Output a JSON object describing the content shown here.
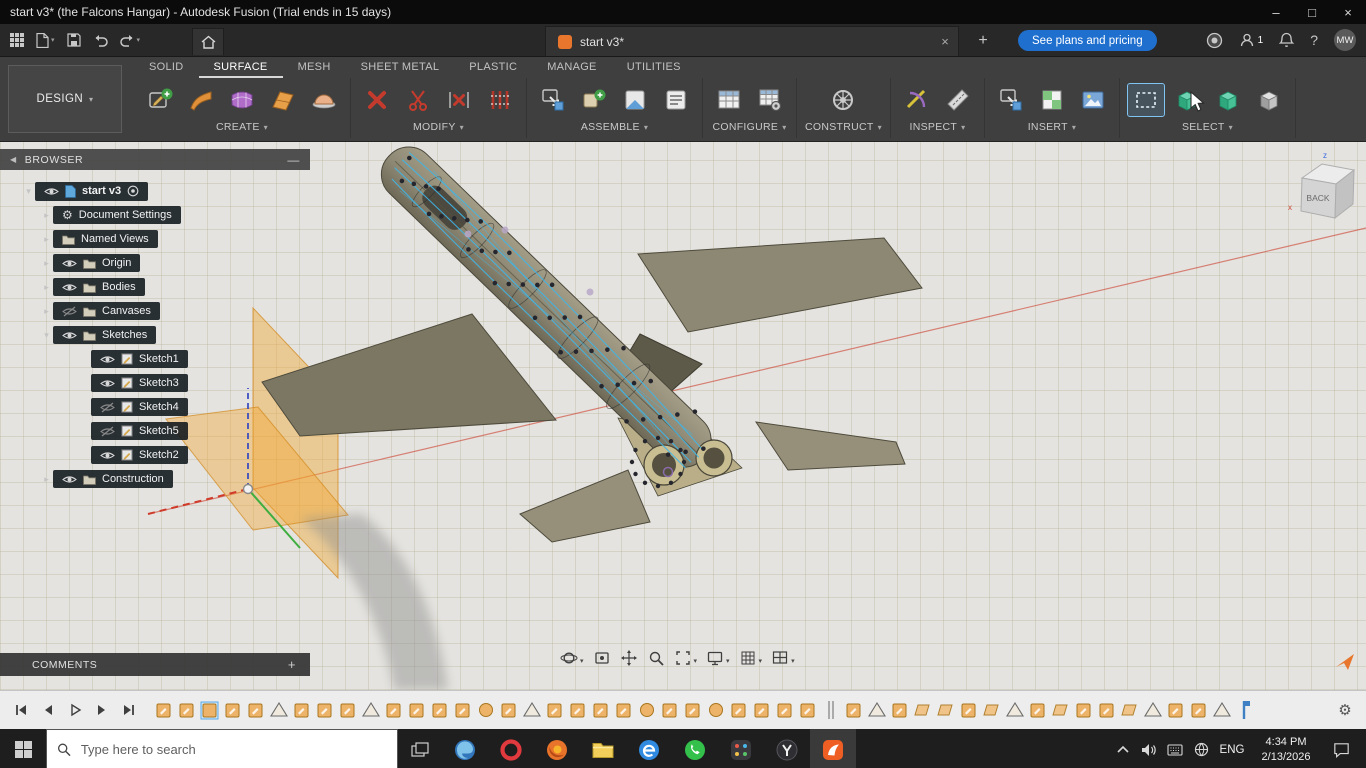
{
  "titlebar": {
    "title": "start v3* (the Falcons Hangar) - Autodesk Fusion (Trial ends in 15 days)",
    "window_controls": [
      {
        "name": "minimize-icon",
        "glyph": "–"
      },
      {
        "name": "maximize-icon",
        "glyph": "□"
      },
      {
        "name": "close-icon",
        "glyph": "×"
      }
    ]
  },
  "appbar": {
    "left_icons": [
      {
        "name": "app-launcher-icon",
        "caret": false
      },
      {
        "name": "new-design-icon",
        "caret": true
      },
      {
        "name": "save-icon",
        "caret": false
      },
      {
        "name": "undo-icon",
        "caret": false
      },
      {
        "name": "redo-icon",
        "caret": true
      }
    ],
    "home_icon": "home-icon",
    "document_tab": {
      "label": "start v3*",
      "close_glyph": "×"
    },
    "add_tab_glyph": "+",
    "plans_button": "See plans and pricing",
    "right_icons": [
      {
        "name": "job-status-icon"
      },
      {
        "name": "profile-icon",
        "badge": "1"
      },
      {
        "name": "notifications-icon"
      },
      {
        "name": "help-icon"
      }
    ],
    "avatar": "MW"
  },
  "ribbon": {
    "workspace": "DESIGN",
    "tabs": [
      {
        "label": "SOLID",
        "active": false
      },
      {
        "label": "SURFACE",
        "active": true
      },
      {
        "label": "MESH",
        "active": false
      },
      {
        "label": "SHEET METAL",
        "active": false
      },
      {
        "label": "PLASTIC",
        "active": false
      },
      {
        "label": "MANAGE",
        "active": false
      },
      {
        "label": "UTILITIES",
        "active": false
      }
    ],
    "groups": [
      {
        "label": "CREATE",
        "icons": [
          {
            "name": "create-sketch-icon",
            "kind": "sketch-new"
          },
          {
            "name": "extrude-icon",
            "kind": "orange-sheet"
          },
          {
            "name": "patch-icon",
            "kind": "purple-patch"
          },
          {
            "name": "loft-icon",
            "kind": "orange-fold"
          },
          {
            "name": "revolve-icon",
            "kind": "sphere"
          }
        ]
      },
      {
        "label": "MODIFY",
        "icons": [
          {
            "name": "trim-icon",
            "kind": "red-x"
          },
          {
            "name": "extend-icon",
            "kind": "red-scissors"
          },
          {
            "name": "stitch-icon",
            "kind": "red-extend"
          },
          {
            "name": "unstitch-icon",
            "kind": "red-stitch"
          }
        ]
      },
      {
        "label": "ASSEMBLE",
        "icons": [
          {
            "name": "new-component-icon",
            "kind": "arrow-box"
          },
          {
            "name": "joint-icon",
            "kind": "green-plus-box"
          },
          {
            "name": "as-built-joint-icon",
            "kind": "corner-box"
          },
          {
            "name": "joint-origin-icon",
            "kind": "list-box"
          }
        ]
      },
      {
        "label": "CONFIGURE",
        "icons": [
          {
            "name": "configuration-icon",
            "kind": "table"
          },
          {
            "name": "configuration-table-icon",
            "kind": "table-gear"
          }
        ]
      },
      {
        "label": "CONSTRUCT",
        "icons": [
          {
            "name": "construction-plane-icon",
            "kind": "wheel"
          }
        ]
      },
      {
        "label": "INSPECT",
        "icons": [
          {
            "name": "measure-icon",
            "kind": "measure"
          },
          {
            "name": "section-analysis-icon",
            "kind": "ruler"
          }
        ]
      },
      {
        "label": "INSERT",
        "icons": [
          {
            "name": "insert-derive-icon",
            "kind": "arrow-box"
          },
          {
            "name": "insert-mesh-icon",
            "kind": "mesh-box"
          },
          {
            "name": "canvas-icon",
            "kind": "image"
          }
        ]
      },
      {
        "label": "SELECT",
        "icons": [
          {
            "name": "select-tool-icon",
            "kind": "dashed-box",
            "highlight": true
          },
          {
            "name": "select-priority-body-icon",
            "kind": "teal-cube"
          },
          {
            "name": "select-priority-face-icon",
            "kind": "teal-cube"
          },
          {
            "name": "select-priority-edge-icon",
            "kind": "gray-cube"
          }
        ]
      }
    ]
  },
  "browser": {
    "header": "BROWSER",
    "root": {
      "label": "start v3"
    },
    "rows": [
      {
        "label": "Document Settings",
        "level": 1,
        "eye": "none",
        "icon": "gear",
        "chevron": "right"
      },
      {
        "label": "Named Views",
        "level": 1,
        "eye": "none",
        "icon": "folder",
        "chevron": "right"
      },
      {
        "label": "Origin",
        "level": 1,
        "eye": "on",
        "icon": "folder",
        "chevron": "right"
      },
      {
        "label": "Bodies",
        "level": 1,
        "eye": "on",
        "icon": "folder",
        "chevron": "right"
      },
      {
        "label": "Canvases",
        "level": 1,
        "eye": "off",
        "icon": "folder",
        "chevron": "right"
      },
      {
        "label": "Sketches",
        "level": 1,
        "eye": "on",
        "icon": "folder",
        "chevron": "down"
      },
      {
        "label": "Sketch1",
        "level": 2,
        "eye": "on",
        "icon": "sketch",
        "chevron": "none"
      },
      {
        "label": "Sketch3",
        "level": 2,
        "eye": "on",
        "icon": "sketch",
        "chevron": "none"
      },
      {
        "label": "Sketch4",
        "level": 2,
        "eye": "off",
        "icon": "sketch",
        "chevron": "none"
      },
      {
        "label": "Sketch5",
        "level": 2,
        "eye": "off",
        "icon": "sketch",
        "chevron": "none"
      },
      {
        "label": "Sketch2",
        "level": 2,
        "eye": "on",
        "icon": "sketch",
        "chevron": "none"
      },
      {
        "label": "Construction",
        "level": 1,
        "eye": "on",
        "icon": "folder",
        "chevron": "right"
      }
    ]
  },
  "comments": {
    "header": "COMMENTS",
    "add_glyph": "+"
  },
  "viewcube": {
    "face": "BACK",
    "axis_x": "x",
    "axis_z": "z"
  },
  "navbar": {
    "items": [
      {
        "name": "orbit-icon",
        "caret": true
      },
      {
        "name": "look-at-icon",
        "caret": false
      },
      {
        "name": "pan-icon",
        "caret": false
      },
      {
        "name": "zoom-icon",
        "caret": false
      },
      {
        "name": "fit-icon",
        "caret": true
      },
      {
        "name": "display-settings-icon",
        "caret": true
      },
      {
        "name": "grid-display-icon",
        "caret": true
      },
      {
        "name": "viewports-icon",
        "caret": true
      }
    ]
  },
  "timeline": {
    "controls": [
      "go-to-start-icon",
      "step-back-icon",
      "play-icon",
      "step-forward-icon",
      "go-to-end-icon"
    ],
    "items": [
      "sq",
      "sq",
      "sq-sel",
      "sq",
      "sq",
      "tri",
      "sq",
      "sq",
      "sq",
      "tri",
      "sq",
      "sq",
      "sq",
      "sq",
      "circ",
      "sq",
      "tri",
      "sq",
      "sq",
      "sq",
      "sq",
      "circ",
      "sq",
      "sq",
      "circ",
      "sq",
      "sq",
      "sq",
      "sq",
      "div",
      "sq",
      "tri",
      "sq",
      "pl",
      "pl",
      "sq",
      "pl",
      "tri",
      "sq",
      "pl",
      "sq",
      "sq",
      "pl",
      "tri",
      "sq",
      "sq",
      "tri",
      "marker"
    ],
    "settings_glyph": "⚙"
  },
  "taskbar": {
    "search_placeholder": "Type here to search",
    "apps": [
      {
        "name": "edge",
        "active": false
      },
      {
        "name": "opera",
        "active": false
      },
      {
        "name": "firefox",
        "active": false
      },
      {
        "name": "file-explorer",
        "active": false
      },
      {
        "name": "edge-legacy",
        "active": false
      },
      {
        "name": "whatsapp",
        "active": false
      },
      {
        "name": "app-grid",
        "active": false
      },
      {
        "name": "media-app",
        "active": false
      },
      {
        "name": "fusion",
        "active": true
      }
    ],
    "tray_icons": [
      "hidden-items-icon",
      "volume-icon",
      "touch-keyboard-icon",
      "network-icon"
    ],
    "language": "ENG",
    "time": "4:34 PM",
    "date": "2/13/2026"
  }
}
